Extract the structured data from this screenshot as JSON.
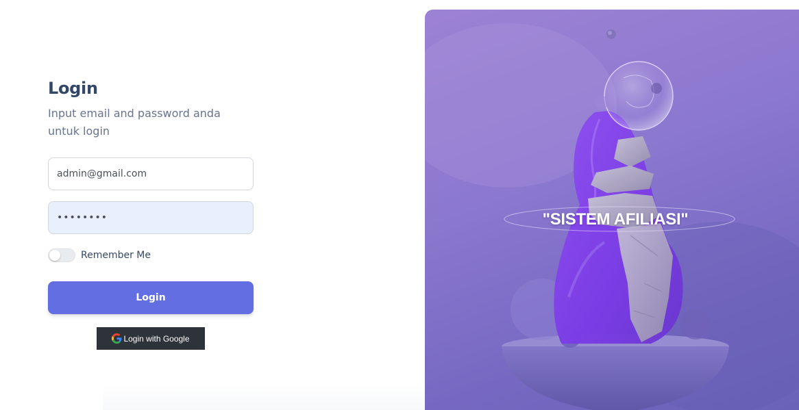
{
  "login_form": {
    "title": "Login",
    "subtitle": "Input email and password anda untuk login",
    "email_value": "admin@gmail.com",
    "password_value": "••••••••",
    "remember_label": "Remember Me",
    "remember_checked": false,
    "login_button_label": "Login",
    "google_button_label": "Login with Google",
    "google_icon": "google-g-icon"
  },
  "hero": {
    "title": "\"SISTEM AFILIASI\""
  },
  "colors": {
    "primary": "#636ee3",
    "heading": "#344767",
    "subtitle": "#67748e",
    "autofill_background": "#e8f0fe",
    "google_button": "#2d3338",
    "hero_purple": "#8b78cf"
  }
}
